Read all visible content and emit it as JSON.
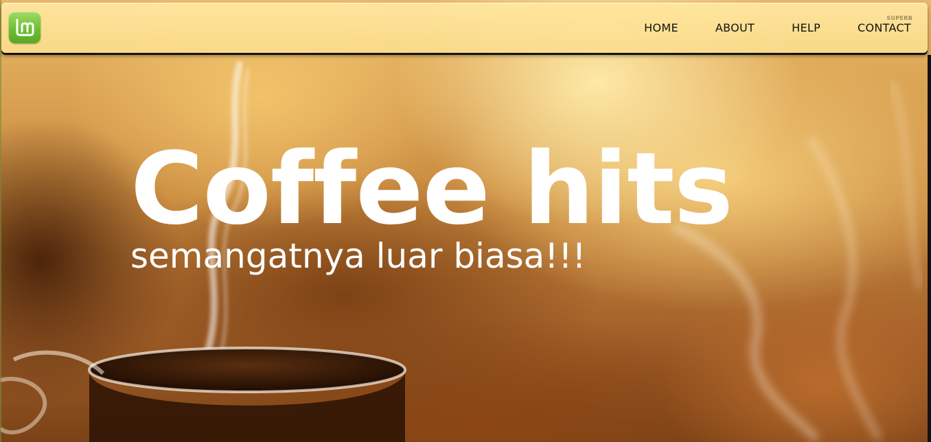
{
  "header": {
    "logo_icon": "linux-mint-logo-icon",
    "logo_color": "#6fbf35",
    "nav": [
      {
        "label": "HOME"
      },
      {
        "label": "ABOUT"
      },
      {
        "label": "HELP"
      },
      {
        "label": "CONTACT"
      }
    ],
    "watermark": "SUPERB"
  },
  "hero": {
    "title": "Coffee hits",
    "subtitle": "semangatnya luar biasa!!!",
    "background_icon": "coffee-steam-photo",
    "text_color": "#ffffff"
  }
}
